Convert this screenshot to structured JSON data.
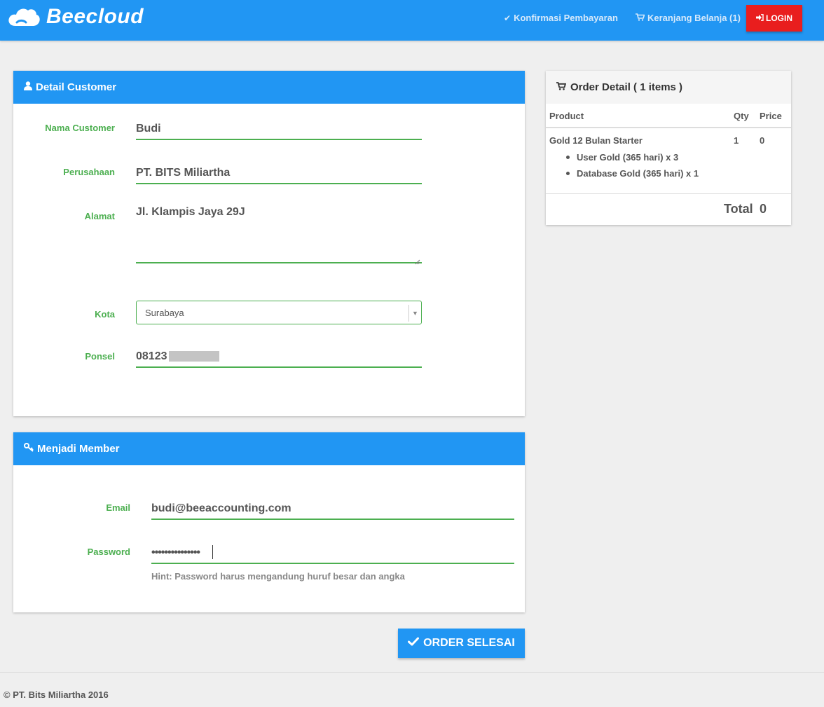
{
  "brand": {
    "name": "Beecloud",
    "logo_icon": "cloud-icon"
  },
  "nav": {
    "confirm_label": "Konfirmasi Pembayaran",
    "confirm_icon": "check-icon",
    "cart_label": "Keranjang Belanja (1)",
    "cart_icon": "cart-icon",
    "login_label": "LOGIN",
    "login_icon": "sign-in-icon",
    "login_color": "#e91e1e"
  },
  "customer": {
    "title": "Detail Customer",
    "icon": "user-icon",
    "fields": {
      "nama": {
        "label": "Nama Customer",
        "value": "Budi"
      },
      "perusahaan": {
        "label": "Perusahaan",
        "value": "PT. BITS Miliartha"
      },
      "alamat": {
        "label": "Alamat",
        "value": "Jl. Klampis Jaya 29J"
      },
      "kota": {
        "label": "Kota",
        "value": "Surabaya"
      },
      "ponsel": {
        "label": "Ponsel",
        "value": "08123"
      }
    }
  },
  "member": {
    "title": "Menjadi Member",
    "icon": "key-icon",
    "email_label": "Email",
    "email_value": "budi@beeaccounting.com",
    "password_label": "Password",
    "password_value": "•••••••••••••••",
    "hint": "Hint: Password harus mengandung huruf besar dan angka"
  },
  "order": {
    "title": "Order Detail ( 1 items )",
    "icon": "cart-icon",
    "columns": {
      "product": "Product",
      "qty": "Qty",
      "price": "Price"
    },
    "item": {
      "name": "Gold 12 Bulan Starter",
      "qty": "1",
      "price": "0",
      "subitems": [
        "User Gold (365 hari) x 3",
        "Database Gold (365 hari) x 1"
      ]
    },
    "total_label": "Total",
    "total_value": "0"
  },
  "submit": {
    "label": "ORDER SELESAI",
    "icon": "check-icon"
  },
  "footer": {
    "text": "© PT. Bits Miliartha 2016"
  },
  "colors": {
    "primary": "#2196f3",
    "accent_green": "#4caf50",
    "background": "#efefef"
  }
}
